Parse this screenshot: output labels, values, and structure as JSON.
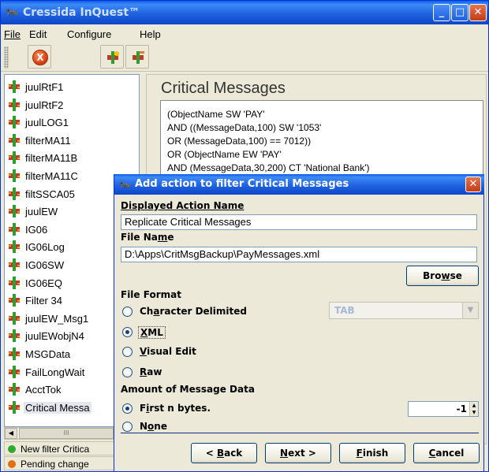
{
  "window": {
    "title": "Cressida InQuest™"
  },
  "menu": [
    "File",
    "Edit",
    "Configure",
    "Help"
  ],
  "toolbar": {
    "stop_label": "X"
  },
  "filters": [
    {
      "label": "juulRtF1"
    },
    {
      "label": "juulRtF2"
    },
    {
      "label": "juulLOG1"
    },
    {
      "label": "filterMA11"
    },
    {
      "label": "filterMA11B"
    },
    {
      "label": "filterMA11C"
    },
    {
      "label": "filtSSCA05"
    },
    {
      "label": "juulEW"
    },
    {
      "label": "IG06"
    },
    {
      "label": "IG06Log"
    },
    {
      "label": "IG06SW"
    },
    {
      "label": "IG06EQ"
    },
    {
      "label": "Filter 34"
    },
    {
      "label": "juulEW_Msg1"
    },
    {
      "label": "juulEWobjN4"
    },
    {
      "label": "MSGData"
    },
    {
      "label": "FailLongWait"
    },
    {
      "label": "AcctTok"
    },
    {
      "label": "Critical Messa"
    }
  ],
  "scrollbar": {
    "left": "◀",
    "thumb": "III"
  },
  "status": [
    {
      "text": "New filter Critica",
      "color": "#2eaa2e"
    },
    {
      "text": "Pending change",
      "color": "#e07010"
    }
  ],
  "panel": {
    "title": "Critical Messages",
    "query": [
      "(ObjectName SW 'PAY'",
      "AND ((MessageData,100) SW '1053'",
      "OR (MessageData,100) == 7012))",
      "OR (ObjectName EW 'PAY'",
      "AND (MessageData,30,200) CT 'National Bank')"
    ]
  },
  "dialog": {
    "title": "Add action to filter Critical Messages",
    "action_name_label": "Displayed Action Name",
    "action_name_value": "Replicate Critical Messages",
    "file_name_label_pre": "File Na",
    "file_name_label_u": "m",
    "file_name_label_post": "e",
    "file_name_value": "D:\\Apps\\CritMsgBackup\\PayMessages.xml",
    "browse_pre": "Bro",
    "browse_u": "w",
    "browse_post": "se",
    "file_format_label": "File Format",
    "formats": [
      {
        "pre": "Ch",
        "u": "a",
        "post": "racter Delimited",
        "selected": false
      },
      {
        "pre": "",
        "u": "X",
        "post": "ML",
        "selected": true
      },
      {
        "pre": "",
        "u": "V",
        "post": "isual Edit",
        "selected": false
      },
      {
        "pre": "",
        "u": "R",
        "post": "aw",
        "selected": false
      }
    ],
    "delimiter_value": "TAB",
    "amount_label": "Amount of Message Data",
    "amount": [
      {
        "pre": "F",
        "u": "i",
        "post": "rst n bytes.",
        "selected": true
      },
      {
        "pre": "N",
        "u": "o",
        "post": "ne",
        "selected": false
      }
    ],
    "bytes_value": "-1",
    "buttons": {
      "back_pre": "< ",
      "back_u": "B",
      "back_post": "ack",
      "next_pre": "",
      "next_u": "N",
      "next_post": "ext >",
      "finish_pre": "",
      "finish_u": "F",
      "finish_post": "inish",
      "cancel_pre": "",
      "cancel_u": "C",
      "cancel_post": "ancel"
    }
  }
}
